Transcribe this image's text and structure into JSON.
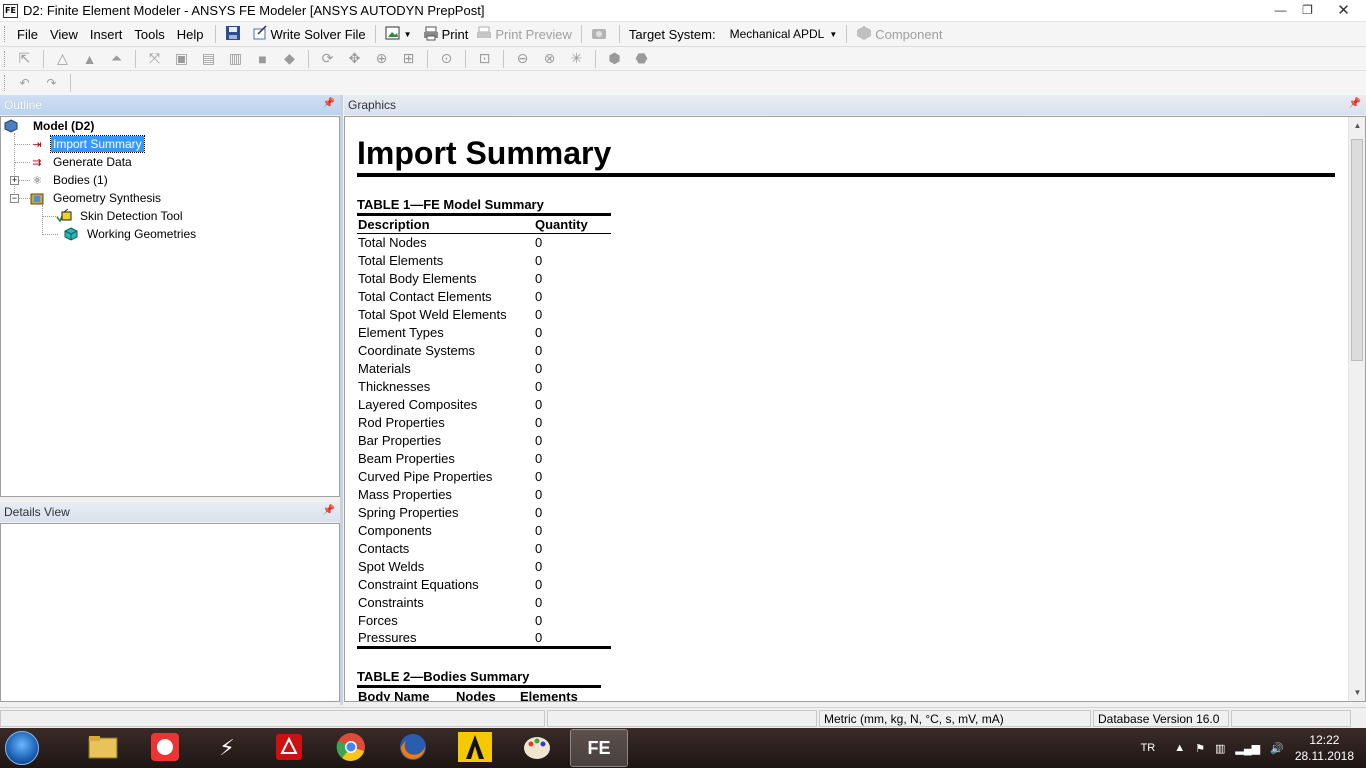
{
  "window": {
    "icon_text": "FE",
    "title": "D2: Finite Element Modeler - ANSYS FE Modeler [ANSYS AUTODYN PrepPost]",
    "minimize": "—",
    "maximize": "❐",
    "close": "✕"
  },
  "menu": {
    "items": [
      "File",
      "View",
      "Insert",
      "Tools",
      "Help"
    ]
  },
  "toolbar": {
    "write_solver_file": "Write Solver File",
    "print": "Print",
    "print_preview": "Print Preview",
    "target_system_label": "Target System:",
    "target_system_value": "Mechanical APDL",
    "component": "Component"
  },
  "outline": {
    "title": "Outline",
    "tree": {
      "model": "Model (D2)",
      "import_summary": "Import Summary",
      "generate_data": "Generate Data",
      "bodies": "Bodies (1)",
      "geometry_synthesis": "Geometry Synthesis",
      "skin_detection_tool": "Skin Detection Tool",
      "working_geometries": "Working Geometries"
    }
  },
  "details": {
    "title": "Details View"
  },
  "graphics": {
    "title": "Graphics",
    "heading": "Import Summary",
    "table1": {
      "caption": "TABLE 1—FE Model Summary",
      "col_description": "Description",
      "col_quantity": "Quantity",
      "rows": [
        {
          "desc": "Total Nodes",
          "qty": "0"
        },
        {
          "desc": "Total Elements",
          "qty": "0"
        },
        {
          "desc": "Total Body Elements",
          "qty": "0"
        },
        {
          "desc": "Total Contact Elements",
          "qty": "0"
        },
        {
          "desc": "Total Spot Weld Elements",
          "qty": "0"
        },
        {
          "desc": "Element Types",
          "qty": "0"
        },
        {
          "desc": "Coordinate Systems",
          "qty": "0"
        },
        {
          "desc": "Materials",
          "qty": "0"
        },
        {
          "desc": "Thicknesses",
          "qty": "0"
        },
        {
          "desc": "Layered Composites",
          "qty": "0"
        },
        {
          "desc": "Rod Properties",
          "qty": "0"
        },
        {
          "desc": "Bar Properties",
          "qty": "0"
        },
        {
          "desc": "Beam Properties",
          "qty": "0"
        },
        {
          "desc": "Curved Pipe Properties",
          "qty": "0"
        },
        {
          "desc": "Mass Properties",
          "qty": "0"
        },
        {
          "desc": "Spring Properties",
          "qty": "0"
        },
        {
          "desc": "Components",
          "qty": "0"
        },
        {
          "desc": "Contacts",
          "qty": "0"
        },
        {
          "desc": "Spot Welds",
          "qty": "0"
        },
        {
          "desc": "Constraint Equations",
          "qty": "0"
        },
        {
          "desc": "Constraints",
          "qty": "0"
        },
        {
          "desc": "Forces",
          "qty": "0"
        },
        {
          "desc": "Pressures",
          "qty": "0"
        }
      ]
    },
    "table2": {
      "caption": "TABLE 2—Bodies Summary",
      "col_body_name": "Body Name",
      "col_nodes": "Nodes",
      "col_elements": "Elements"
    }
  },
  "statusbar": {
    "units": "Metric (mm, kg, N, °C, s, mV, mA)",
    "database_version": "Database Version 16.0"
  },
  "taskbar": {
    "apps": [
      "windows-explorer",
      "image-viewer",
      "winamp-like",
      "acrobat",
      "chrome",
      "firefox",
      "ansys-autodyn",
      "paint",
      "fe-modeler"
    ],
    "active_app": "FE",
    "language": "TR",
    "time": "12:22",
    "date": "28.11.2018"
  },
  "colors": {
    "selection": "#3399ff",
    "panel_header": "#bcd3ee",
    "taskbar": "#2a1f1d"
  }
}
